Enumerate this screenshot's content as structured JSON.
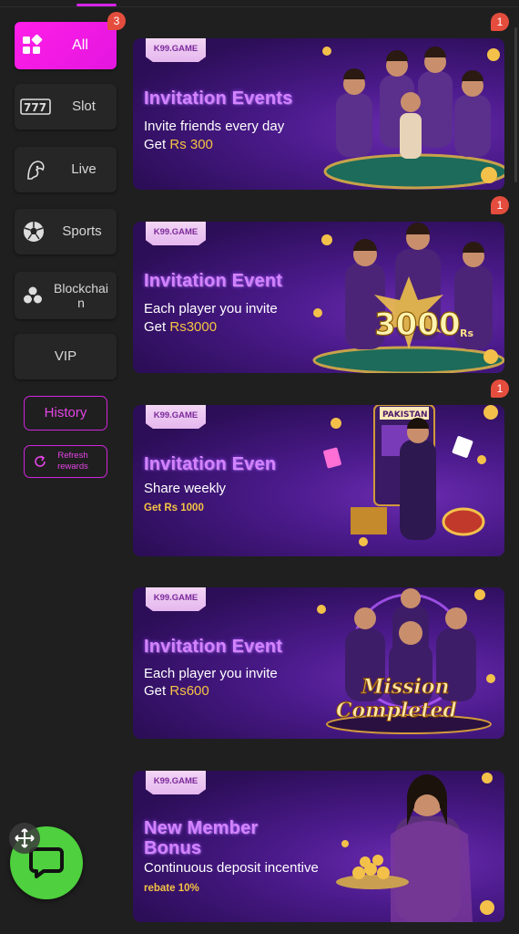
{
  "tabs_indicator": "active",
  "sidebar": {
    "categories": [
      {
        "label": "All",
        "icon": "grid-icon",
        "badge": "3",
        "active": true
      },
      {
        "label": "Slot",
        "icon": "slot-777-icon"
      },
      {
        "label": "Live",
        "icon": "live-dealer-icon"
      },
      {
        "label": "Sports",
        "icon": "soccer-ball-icon"
      },
      {
        "label": "Blockchain",
        "icon": "blockchain-icon"
      },
      {
        "label": "VIP"
      }
    ],
    "history_label": "History",
    "refresh_label": "Refresh rewards"
  },
  "promos": [
    {
      "tag": "K99.GAME",
      "title": "Invitation Events",
      "subtitle": "Invite friends every day",
      "amount_prefix": "Get ",
      "amount": "Rs 300",
      "badge": "1"
    },
    {
      "tag": "K99.GAME",
      "title": "Invitation Event",
      "subtitle": "Each player you invite",
      "amount_prefix": "Get ",
      "amount": "Rs3000",
      "badge": "1",
      "art_text": "3000",
      "art_unit": "Rs"
    },
    {
      "tag": "K99.GAME",
      "title": "Invitation Even",
      "subtitle": "Share weekly",
      "amount_prefix": "",
      "amount": "Get Rs 1000",
      "badge": "1",
      "art_text": "PAKISTAN"
    },
    {
      "tag": "K99.GAME",
      "title": "Invitation Event",
      "subtitle": "Each player you invite",
      "amount_prefix": "Get ",
      "amount": "Rs600",
      "art_text": "Mission",
      "art_text2": "Completed"
    },
    {
      "tag": "K99.GAME",
      "title": "New Member",
      "title2": "Bonus",
      "subtitle": "Continuous deposit incentive",
      "amount_prefix": "",
      "amount": "rebate 10%"
    }
  ],
  "colors": {
    "accent": "#e316e0",
    "badge": "#e44d3d",
    "chat": "#4ed03f",
    "gold": "#f6c343"
  }
}
